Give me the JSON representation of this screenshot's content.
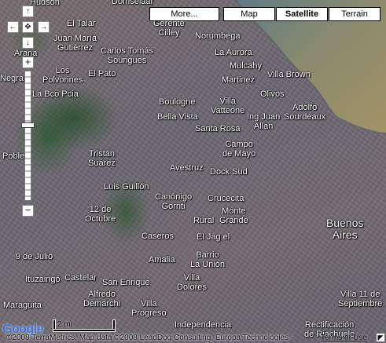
{
  "map_type_buttons": {
    "more": "More...",
    "map": "Map",
    "satellite": "Satellite",
    "terrain": "Terrain",
    "active": "Satellite"
  },
  "controls": {
    "pan_up": "↑",
    "pan_left": "←",
    "pan_center": "✥",
    "pan_right": "→",
    "pan_down": "↓",
    "zoom_in": "+",
    "zoom_out": "−"
  },
  "places": [
    {
      "name": "place-hudson",
      "text": "Hudson"
    },
    {
      "name": "place-domselaar",
      "text": "Domselaar"
    },
    {
      "name": "place-el-talar",
      "text": "El Talar"
    },
    {
      "name": "place-gerente-cilley",
      "text": "Gerente\nCilley"
    },
    {
      "name": "place-juan-maria-gutierrez",
      "text": "Juan María\nGutiérrez"
    },
    {
      "name": "place-norumbega",
      "text": "Norumbega"
    },
    {
      "name": "place-arana",
      "text": "Arana"
    },
    {
      "name": "place-carlos-tomas-sourigues",
      "text": "Carlos Tomás\nSourigues"
    },
    {
      "name": "place-la-aurora",
      "text": "La Aurora"
    },
    {
      "name": "place-negra",
      "text": "Negra"
    },
    {
      "name": "place-los-polvorines",
      "text": "Los\nPolvorines"
    },
    {
      "name": "place-el-pato",
      "text": "El Pato"
    },
    {
      "name": "place-mulcahy",
      "text": "Mulcahy"
    },
    {
      "name": "place-villa-brown",
      "text": "Villa Brown"
    },
    {
      "name": "place-martinez",
      "text": "Martinez"
    },
    {
      "name": "place-la-bco-pcia",
      "text": "La Bco Pcia"
    },
    {
      "name": "place-olivos",
      "text": "Olivos"
    },
    {
      "name": "place-boulogne",
      "text": "Boulogne"
    },
    {
      "name": "place-villa-vatteone",
      "text": "Villa\nVatteone"
    },
    {
      "name": "place-adolfo-sourdeaux",
      "text": "Adolfo\nSourdeaux"
    },
    {
      "name": "place-bella-vista",
      "text": "Bella Vista"
    },
    {
      "name": "place-ing-juan-allan",
      "text": "Ing Juan\nAllan"
    },
    {
      "name": "place-santa-rosa",
      "text": "Santa Rosa"
    },
    {
      "name": "place-campo-de-mayo",
      "text": "Campo\nde Mayo"
    },
    {
      "name": "place-poblet",
      "text": "Poblet"
    },
    {
      "name": "place-tristan-suarez",
      "text": "Tristán\nSuárez"
    },
    {
      "name": "place-avestruz",
      "text": "Avestruz"
    },
    {
      "name": "place-dock-sud",
      "text": "Dock Sud"
    },
    {
      "name": "place-luis-guillon",
      "text": "Luis Guillón"
    },
    {
      "name": "place-canonigo-gorriti",
      "text": "Canónigo\nGorriti"
    },
    {
      "name": "place-crucecita",
      "text": "Crucecita"
    },
    {
      "name": "place-12-de-octubre",
      "text": "12 de\nOctubre"
    },
    {
      "name": "place-monte-grande",
      "text": "Monte\nGrande"
    },
    {
      "name": "place-rural",
      "text": "Rural"
    },
    {
      "name": "place-buenos-aires",
      "text": "Buenos\nAires",
      "big": true
    },
    {
      "name": "place-el-jagel",
      "text": "El Jag el"
    },
    {
      "name": "place-caseros",
      "text": "Caseros"
    },
    {
      "name": "place-9-de-julio",
      "text": "9 de Julio"
    },
    {
      "name": "place-amalia",
      "text": "Amalia"
    },
    {
      "name": "place-barrio-la-union",
      "text": "Barrio\nLa Unión"
    },
    {
      "name": "place-ituzaingo",
      "text": "Ituzaingó"
    },
    {
      "name": "place-castelar",
      "text": "Castelar"
    },
    {
      "name": "place-san-enrique",
      "text": "San Enrique"
    },
    {
      "name": "place-villa-dolores",
      "text": "Villa\nDolores"
    },
    {
      "name": "place-villa-11-de-septiembre",
      "text": "Villa 11 de\nSeptiembre"
    },
    {
      "name": "place-maraguita",
      "text": "Maraguita"
    },
    {
      "name": "place-alfredo-demarchi",
      "text": "Alfredo\nDemarchi"
    },
    {
      "name": "place-villa-progreso",
      "text": "Villa\nProgreso"
    },
    {
      "name": "place-independencia",
      "text": "Independencia"
    },
    {
      "name": "place-rectificacion-riachuelo",
      "text": "Rectificación\nde Riachuelo"
    }
  ],
  "logo_text": "Google",
  "scale_label": "2 mi",
  "copyright": "©2008 TerraMetrics, Map data ©2008 LeadDog Consulting, Europa Technologies -",
  "terms_link": "Terms of Use",
  "colors": {
    "water": "#7f8b86",
    "water_shallow": "#9a8f6a",
    "vegetation": "#3e5e40"
  }
}
